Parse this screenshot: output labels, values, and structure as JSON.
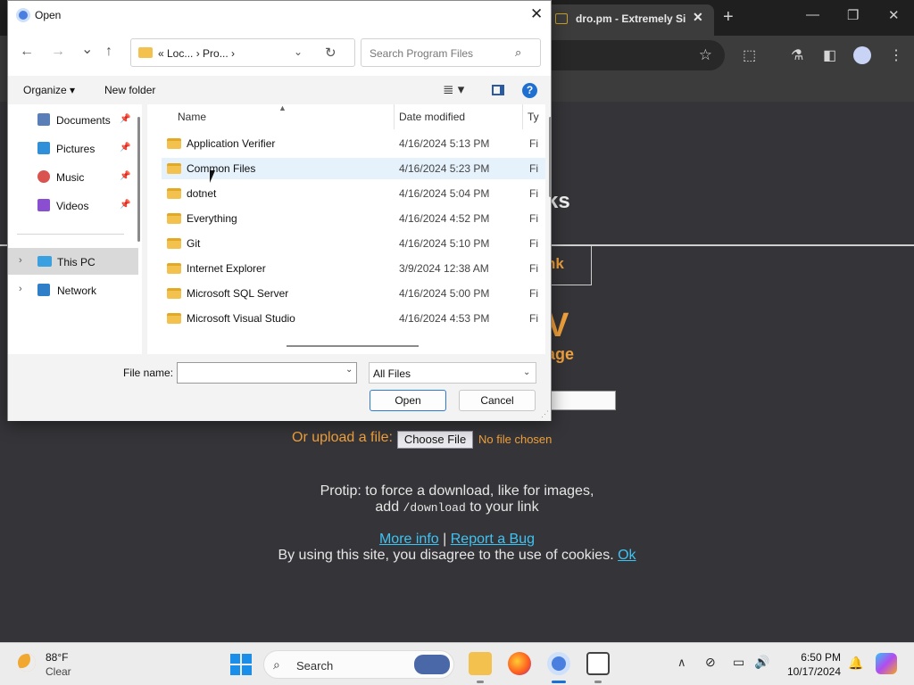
{
  "browser": {
    "tab_title": "dro.pm - Extremely Si",
    "tab_close": "✕",
    "new_tab": "+",
    "win_minimize": "—",
    "win_maximize": "❐",
    "win_close": "✕",
    "star_glyph": "☆"
  },
  "page": {
    "heading_fragment": "ks",
    "link_fragment": "nk",
    "big_fragment": "V",
    "sub_fragment": "age",
    "upload_label": "Or upload a file:",
    "choose_file": "Choose File",
    "no_file": "No file chosen",
    "protip_line1": "Protip: to force a download, like for images,",
    "protip_add": "add ",
    "protip_code": "/download",
    "protip_tail": " to your link",
    "more_info": "More info",
    "separator": "|",
    "report_bug": "Report a Bug",
    "cookie_text": "By using this site, you disagree to the use of cookies.",
    "cookie_ok": "Ok"
  },
  "dialog": {
    "title": "Open",
    "close_glyph": "✕",
    "nav": {
      "back": "←",
      "forward": "→",
      "recent": "⌄",
      "up": "↑"
    },
    "address": {
      "path": "«  Loc...  ›  Pro...  ›",
      "dropdown": "⌄",
      "refresh": "↻"
    },
    "search": {
      "placeholder": "Search Program Files",
      "icon_glyph": "⌕"
    },
    "commands": {
      "organize": "Organize ▾",
      "new_folder": "New folder",
      "view_glyph": "≣ ▾",
      "help_glyph": "?"
    },
    "nav_pane": [
      {
        "label": "Documents",
        "pin": "📌",
        "color": "#5a7fb8"
      },
      {
        "label": "Pictures",
        "pin": "📌",
        "color": "#2f8fd8"
      },
      {
        "label": "Music",
        "pin": "📌",
        "color": "#d9534f"
      },
      {
        "label": "Videos",
        "pin": "📌",
        "color": "#8a4fd0"
      },
      {
        "label": "This PC",
        "chev": "›",
        "color": "#3aa0e0"
      },
      {
        "label": "Network",
        "chev": "›",
        "color": "#2f7fc8"
      }
    ],
    "columns": {
      "name": "Name",
      "date": "Date modified",
      "type": "Ty",
      "sort_glyph": "▲"
    },
    "files": [
      {
        "name": "Application Verifier",
        "date": "4/16/2024 5:13 PM",
        "type": "Fi"
      },
      {
        "name": "Common Files",
        "date": "4/16/2024 5:23 PM",
        "type": "Fi"
      },
      {
        "name": "dotnet",
        "date": "4/16/2024 5:04 PM",
        "type": "Fi"
      },
      {
        "name": "Everything",
        "date": "4/16/2024 4:52 PM",
        "type": "Fi"
      },
      {
        "name": "Git",
        "date": "4/16/2024 5:10 PM",
        "type": "Fi"
      },
      {
        "name": "Internet Explorer",
        "date": "3/9/2024 12:38 AM",
        "type": "Fi"
      },
      {
        "name": "Microsoft SQL Server",
        "date": "4/16/2024 5:00 PM",
        "type": "Fi"
      },
      {
        "name": "Microsoft Visual Studio",
        "date": "4/16/2024 4:53 PM",
        "type": "Fi"
      }
    ],
    "file_name_label": "File name:",
    "file_name_value": "",
    "dropdown_glyph": "⌄",
    "file_type": "All Files",
    "open_button": "Open",
    "cancel_button": "Cancel",
    "grip_glyph": "⋰"
  },
  "taskbar": {
    "temperature": "88°F",
    "weather": "Clear",
    "search_label": "Search",
    "search_glyph": "⌕",
    "tray_chevron": "∧",
    "tray_icons": [
      "⊘",
      "▭",
      "🔊"
    ],
    "time": "6:50 PM",
    "date": "10/17/2024",
    "notif_glyph": "🔔"
  },
  "colors": {
    "page_bg": "#353539",
    "accent_orange": "#f2a13b",
    "link_blue": "#3ec3f3",
    "dialog_focus_blue": "#2b7bd0"
  }
}
